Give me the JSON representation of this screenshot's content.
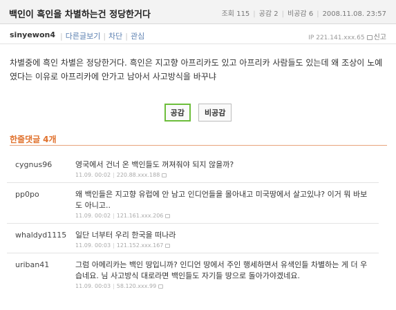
{
  "post": {
    "title": "백인이 흑인을 차별하는건 정당한거다",
    "views_label": "조회",
    "views": "115",
    "likes_label": "공감",
    "likes": "2",
    "dislikes_label": "비공감",
    "dislikes": "6",
    "datetime": "2008.11.08. 23:57",
    "author": "sinyewon4",
    "links": [
      "다른글보기",
      "차단",
      "관심"
    ],
    "ip": "IP 221.141.xxx.65",
    "report_label": "신고",
    "body": "차별중에 흑인 차별은 정당한거다. 흑인은 지고향 아프리카도 있고 아프리카 사람들도 있는데 왜 조상이 노예였다는 이유로 아프리카에 안가고 남아서 사고방식을 바꾸냐"
  },
  "vote": {
    "agree_label": "공감",
    "disagree_label": "비공감"
  },
  "comments_header": {
    "label": "한줄댓글",
    "count": "4개"
  },
  "comments": [
    {
      "user": "cygnus96",
      "text": "영국에서 건너 온 백인들도 꺼져줘야 되지 않을까?",
      "date": "11.09. 00:02",
      "ip": "220.88.xxx.188"
    },
    {
      "user": "pp0po",
      "text": "왜 백인들은 지고향 유럽에 안 남고 인디언들을 몰아내고 미국땅에서 살고있냐? 이거 뭐 바보도 아니고..",
      "date": "11.09. 00:02",
      "ip": "121.161.xxx.206"
    },
    {
      "user": "whaldyd1115",
      "text": "일단 너부터 우리 한국을 떠나라",
      "date": "11.09. 00:03",
      "ip": "121.152.xxx.167"
    },
    {
      "user": "uriban41",
      "text": "그럼 아메리카는 백인 땅입니까? 인디언 땅에서 주인 행세하면서 유색인들 차별하는 게 더 우습네요. 님 사고방식 대로라면 백인들도 자기들 땅으로 돌아가야겠네요.",
      "date": "11.09. 00:03",
      "ip": "58.120.xxx.99"
    }
  ]
}
